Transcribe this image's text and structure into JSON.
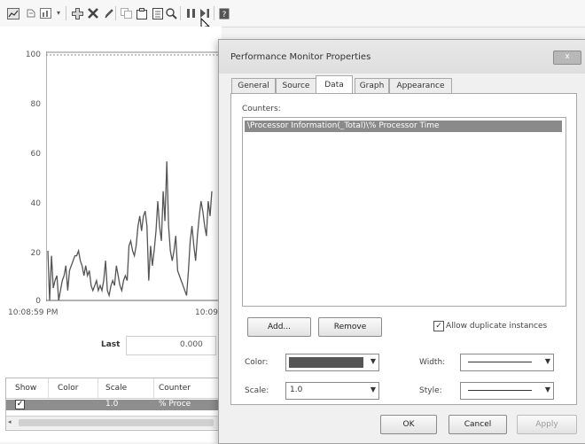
{
  "toolbar": {
    "icons": [
      "view-graph-icon",
      "freeze-icon",
      "change-graph-type-icon",
      "dropdown-arrow-icon",
      "add-counter-icon",
      "delete-counter-icon",
      "highlight-icon",
      "copy-properties-icon",
      "paste-counter-list-icon",
      "properties-icon",
      "zoom-icon",
      "pause-icon",
      "update-data-icon",
      "help-icon"
    ]
  },
  "graph": {
    "y_ticks": [
      "100",
      "80",
      "60",
      "40",
      "20",
      "0"
    ],
    "x_start": "10:08:59 PM",
    "x_mid": "10:09",
    "last_label": "Last",
    "last_value": "0.000"
  },
  "counter_table": {
    "headers": [
      "Show",
      "Color",
      "Scale",
      "Counter"
    ],
    "row": {
      "scale": "1.0",
      "counter": "% Proce"
    }
  },
  "chart_data": {
    "type": "line",
    "x": [
      0,
      1,
      2,
      3,
      4,
      5,
      6,
      7,
      8,
      9,
      10,
      11,
      12,
      13,
      14,
      15,
      16,
      17,
      18,
      19,
      20,
      21,
      22,
      23,
      24,
      25,
      26,
      27,
      28,
      29,
      30,
      31,
      32,
      33,
      34,
      35,
      36,
      37,
      38,
      39,
      40,
      41,
      42,
      43,
      44,
      45,
      46,
      47,
      48,
      49,
      50,
      51,
      52,
      53,
      54,
      55,
      56,
      57,
      58,
      59,
      60,
      61,
      62,
      63,
      64,
      65,
      66,
      67,
      68,
      69,
      70,
      71,
      72,
      73,
      74,
      75,
      76,
      77,
      78,
      79,
      80,
      81,
      82,
      83,
      84,
      85,
      86,
      87,
      88,
      89,
      90,
      91
    ],
    "series": [
      {
        "values": [
          20,
          0,
          18,
          5,
          8,
          10,
          0,
          4,
          8,
          10,
          14,
          4,
          12,
          14,
          16,
          18,
          18,
          20,
          16,
          14,
          10,
          14,
          10,
          12,
          6,
          4,
          6,
          8,
          4,
          6,
          4,
          8,
          16,
          4,
          2,
          6,
          8,
          6,
          14,
          10,
          6,
          4,
          8,
          10,
          8,
          22,
          24,
          20,
          18,
          22,
          30,
          34,
          28,
          34,
          36,
          30,
          8,
          22,
          14,
          20,
          28,
          40,
          30,
          24,
          44,
          32,
          56,
          30,
          20,
          16,
          20,
          26,
          12,
          10,
          8,
          6,
          4,
          2,
          12,
          24,
          30,
          22,
          16,
          26,
          34,
          40,
          36,
          30,
          26,
          40,
          34,
          44
        ]
      }
    ],
    "ylim": [
      0,
      100
    ],
    "grid": false
  },
  "dialog": {
    "title": "Performance Monitor Properties",
    "close_label": "x",
    "tabs": [
      "General",
      "Source",
      "Data",
      "Graph",
      "Appearance"
    ],
    "active_tab": "Data",
    "counters_label": "Counters:",
    "counters": [
      "\\Processor Information(_Total)\\% Processor Time"
    ],
    "add_label": "Add...",
    "remove_label": "Remove",
    "allow_duplicate_label": "Allow duplicate instances",
    "color_label": "Color:",
    "width_label": "Width:",
    "scale_label": "Scale:",
    "scale_value": "1.0",
    "style_label": "Style:",
    "ok_label": "OK",
    "cancel_label": "Cancel",
    "apply_label": "Apply"
  }
}
